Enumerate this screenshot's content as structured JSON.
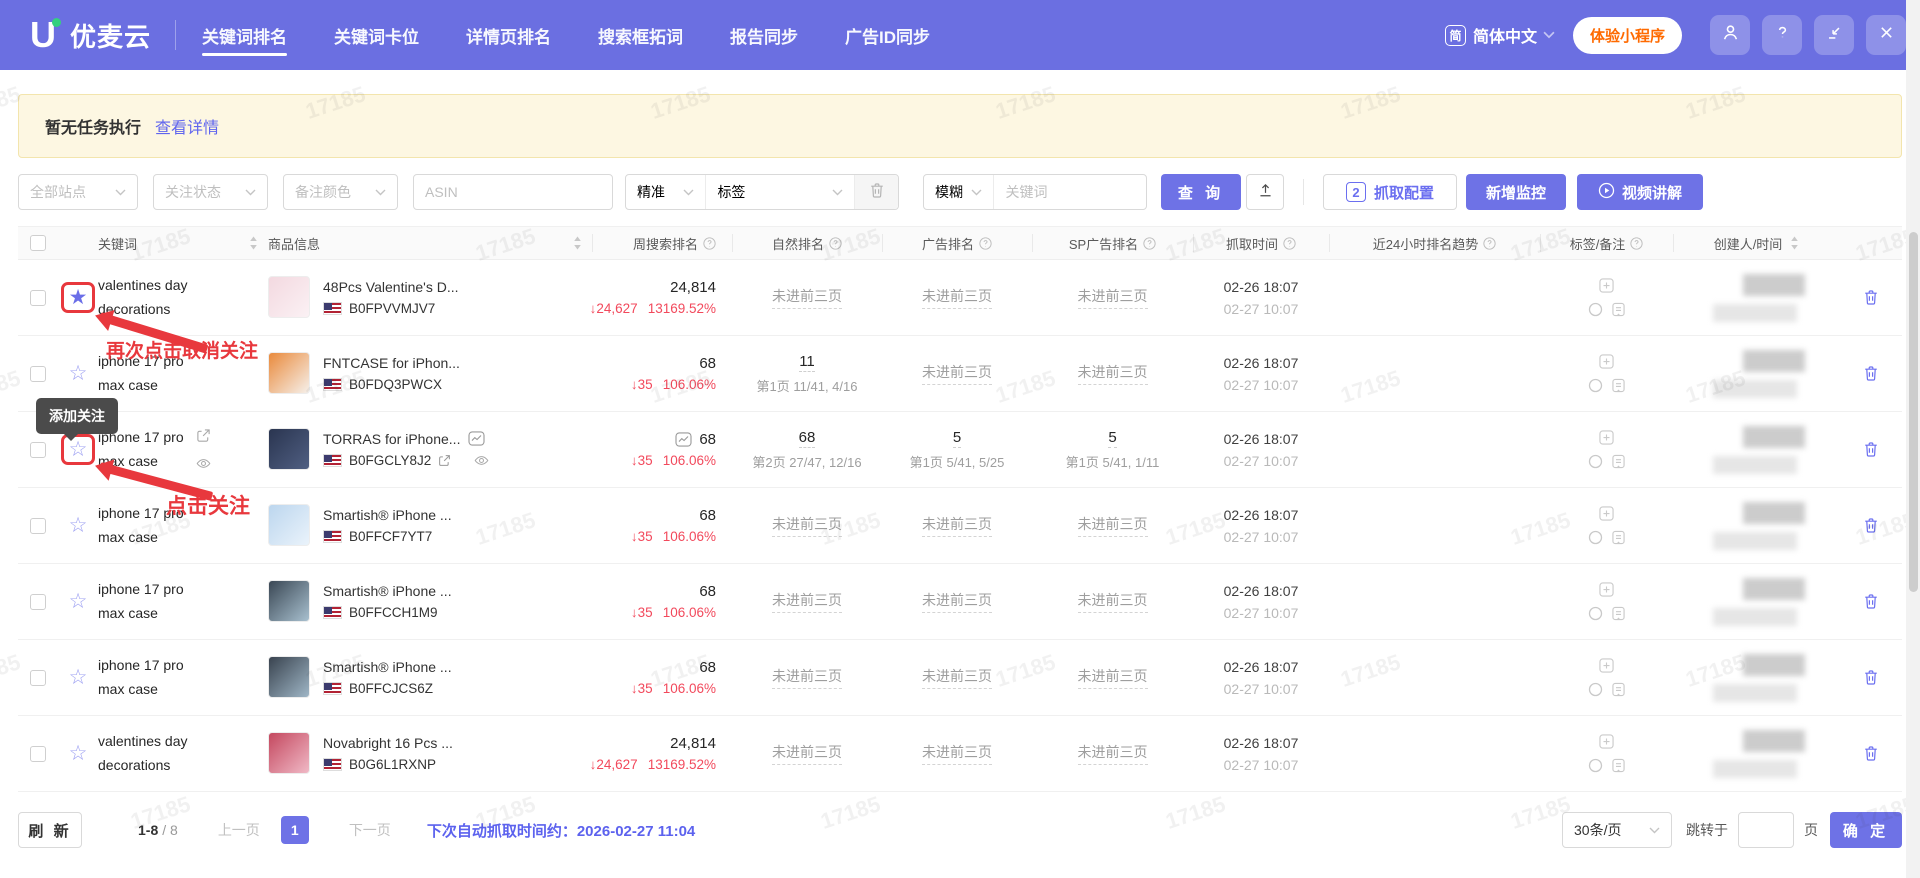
{
  "watermark_text": "17185",
  "colors": {
    "navbar": "#6b6fe1",
    "primary_button": "#6e72e6",
    "link": "#6065ee",
    "rank_down_red": "#f2495c",
    "annotation_red": "#e8383d",
    "mini_program_text": "#ff6a00",
    "notice_bg": "#fdf7e2",
    "star_filled": "#6a6ee8",
    "star_outline": "#9da0f2",
    "row_trash": "#6b6ff0"
  },
  "icons": [
    "logo-u-icon",
    "language-icon",
    "chevron-down-icon",
    "user-icon",
    "help-icon",
    "collapse-icon",
    "close-icon",
    "trash-icon",
    "upload-icon",
    "play-icon",
    "info-icon",
    "sort-icon",
    "star-icon",
    "share-icon",
    "eye-icon",
    "external-link-icon",
    "trend-chart-icon",
    "add-tag-icon",
    "color-circle-icon",
    "note-icon",
    "us-flag-icon"
  ],
  "nav": {
    "brand": "优麦云",
    "items": [
      {
        "label": "关键词排名",
        "active": true
      },
      {
        "label": "关键词卡位",
        "active": false
      },
      {
        "label": "详情页排名",
        "active": false
      },
      {
        "label": "搜索框拓词",
        "active": false
      },
      {
        "label": "报告同步",
        "active": false
      },
      {
        "label": "广告ID同步",
        "active": false
      }
    ],
    "lang_icon": "简",
    "language": "简体中文",
    "mini_program": "体验小程序"
  },
  "notice": {
    "text": "暂无任务执行",
    "link": "查看详情"
  },
  "filters": {
    "site_placeholder": "全部站点",
    "follow_placeholder": "关注状态",
    "note_color_placeholder": "备注颜色",
    "asin_placeholder": "ASIN",
    "match_exact": "精准",
    "tag_placeholder": "标签",
    "match_fuzzy": "模糊",
    "keyword_placeholder": "关键词",
    "search_button": "查 询",
    "config_badge": "2",
    "config_button": "抓取配置",
    "add_button": "新增监控",
    "video_button": "视频讲解"
  },
  "table": {
    "no_rank": "未进前三页",
    "columns": [
      {
        "key": "check",
        "label": ""
      },
      {
        "key": "star",
        "label": ""
      },
      {
        "key": "kw",
        "label": "关键词",
        "sort": true
      },
      {
        "key": "prod",
        "label": "商品信息",
        "sort": true
      },
      {
        "key": "week",
        "label": "周搜索排名",
        "info": true,
        "sep": true
      },
      {
        "key": "nat",
        "label": "自然排名",
        "info": true,
        "sep": true
      },
      {
        "key": "ad",
        "label": "广告排名",
        "info": true,
        "sep": true
      },
      {
        "key": "sp",
        "label": "SP广告排名",
        "info": true,
        "sep": true
      },
      {
        "key": "time",
        "label": "抓取时间",
        "info": true,
        "sep": true
      },
      {
        "key": "trend",
        "label": "近24小时排名趋势",
        "info": true,
        "sep": true
      },
      {
        "key": "tags",
        "label": "标签/备注",
        "info": true,
        "sep": true
      },
      {
        "key": "creator",
        "label": "创建人/时间",
        "sort": true,
        "sep": true
      },
      {
        "key": "act",
        "label": ""
      }
    ],
    "rows": [
      {
        "keyword": [
          "valentines day",
          "decorations"
        ],
        "star": "filled",
        "star_boxed": true,
        "product": {
          "title": "48Pcs Valentine's D...",
          "asin": "B0FPVVMJV7",
          "img": [
            "#f3d9e0",
            "#fbf1f4"
          ]
        },
        "week": {
          "value": "24,814",
          "delta": "24,627",
          "pct": "13169.52%",
          "trend_icon": false
        },
        "natural": {
          "value": null
        },
        "ad": {
          "value": null
        },
        "sp": {
          "value": null
        },
        "time1": "02-26 18:07",
        "time2": "02-27 10:07"
      },
      {
        "keyword": [
          "iphone 17 pro",
          "max case"
        ],
        "star": "outline",
        "star_boxed": false,
        "product": {
          "title": "FNTCASE for iPhon...",
          "asin": "B0FDQ3PWCX",
          "img": [
            "#e98a3c",
            "#f6f0ea"
          ]
        },
        "week": {
          "value": "68",
          "delta": "35",
          "pct": "106.06%",
          "trend_icon": false
        },
        "natural": {
          "value": "11",
          "detail": "第1页 11/41, 4/16"
        },
        "ad": {
          "value": null
        },
        "sp": {
          "value": null
        },
        "time1": "02-26 18:07",
        "time2": "02-27 10:07"
      },
      {
        "keyword": [
          "iphone 17 pro",
          "max case"
        ],
        "star": "outline",
        "star_boxed": true,
        "hover_icons": true,
        "product": {
          "title": "TORRAS for iPhone...",
          "asin": "B0FGCLY8J2",
          "img": [
            "#2a3550",
            "#505f82"
          ],
          "title_icon": true,
          "link_icon": true,
          "eye_icon": true
        },
        "week": {
          "value": "68",
          "delta": "35",
          "pct": "106.06%",
          "trend_icon": true
        },
        "natural": {
          "value": "68",
          "detail": "第2页 27/47, 12/16"
        },
        "ad": {
          "value": "5",
          "detail": "第1页 5/41, 5/25"
        },
        "sp": {
          "value": "5",
          "detail": "第1页 5/41, 1/11"
        },
        "time1": "02-26 18:07",
        "time2": "02-27 10:07"
      },
      {
        "keyword": [
          "iphone 17 pro",
          "max case"
        ],
        "star": "outline",
        "star_boxed": false,
        "product": {
          "title": "Smartish® iPhone ...",
          "asin": "B0FFCF7YT7",
          "img": [
            "#bcd6ee",
            "#eaf3fb"
          ]
        },
        "week": {
          "value": "68",
          "delta": "35",
          "pct": "106.06%",
          "trend_icon": false
        },
        "natural": {
          "value": null
        },
        "ad": {
          "value": null
        },
        "sp": {
          "value": null
        },
        "time1": "02-26 18:07",
        "time2": "02-27 10:07"
      },
      {
        "keyword": [
          "iphone 17 pro",
          "max case"
        ],
        "star": "outline",
        "star_boxed": false,
        "product": {
          "title": "Smartish® iPhone ...",
          "asin": "B0FFCCH1M9",
          "img": [
            "#3a4754",
            "#a8c0cf"
          ]
        },
        "week": {
          "value": "68",
          "delta": "35",
          "pct": "106.06%",
          "trend_icon": false
        },
        "natural": {
          "value": null
        },
        "ad": {
          "value": null
        },
        "sp": {
          "value": null
        },
        "time1": "02-26 18:07",
        "time2": "02-27 10:07"
      },
      {
        "keyword": [
          "iphone 17 pro",
          "max case"
        ],
        "star": "outline",
        "star_boxed": false,
        "product": {
          "title": "Smartish® iPhone ...",
          "asin": "B0FFCJCS6Z",
          "img": [
            "#39434f",
            "#9fb6c6"
          ]
        },
        "week": {
          "value": "68",
          "delta": "35",
          "pct": "106.06%",
          "trend_icon": false
        },
        "natural": {
          "value": null
        },
        "ad": {
          "value": null
        },
        "sp": {
          "value": null
        },
        "time1": "02-26 18:07",
        "time2": "02-27 10:07"
      },
      {
        "keyword": [
          "valentines day",
          "decorations"
        ],
        "star": "outline",
        "star_boxed": false,
        "product": {
          "title": "Novabright 16 Pcs ...",
          "asin": "B0G6L1RXNP",
          "img": [
            "#c4485f",
            "#f0b9c6"
          ]
        },
        "week": {
          "value": "24,814",
          "delta": "24,627",
          "pct": "13169.52%",
          "trend_icon": false
        },
        "natural": {
          "value": null
        },
        "ad": {
          "value": null
        },
        "sp": {
          "value": null
        },
        "time1": "02-26 18:07",
        "time2": "02-27 10:07"
      }
    ]
  },
  "annotations": {
    "tooltip": "添加关注",
    "arrow1_label": "再次点击取消关注",
    "arrow2_label": "点击关注"
  },
  "pagination": {
    "refresh": "刷 新",
    "range": "1-8",
    "total": "/ 8",
    "prev": "上一页",
    "page": "1",
    "next": "下一页",
    "next_fetch_label": "下次自动抓取时间约：",
    "next_fetch_time": "2026-02-27 11:04",
    "page_size": "30条/页",
    "jump_label": "跳转于",
    "jump_unit": "页",
    "confirm": "确 定"
  }
}
